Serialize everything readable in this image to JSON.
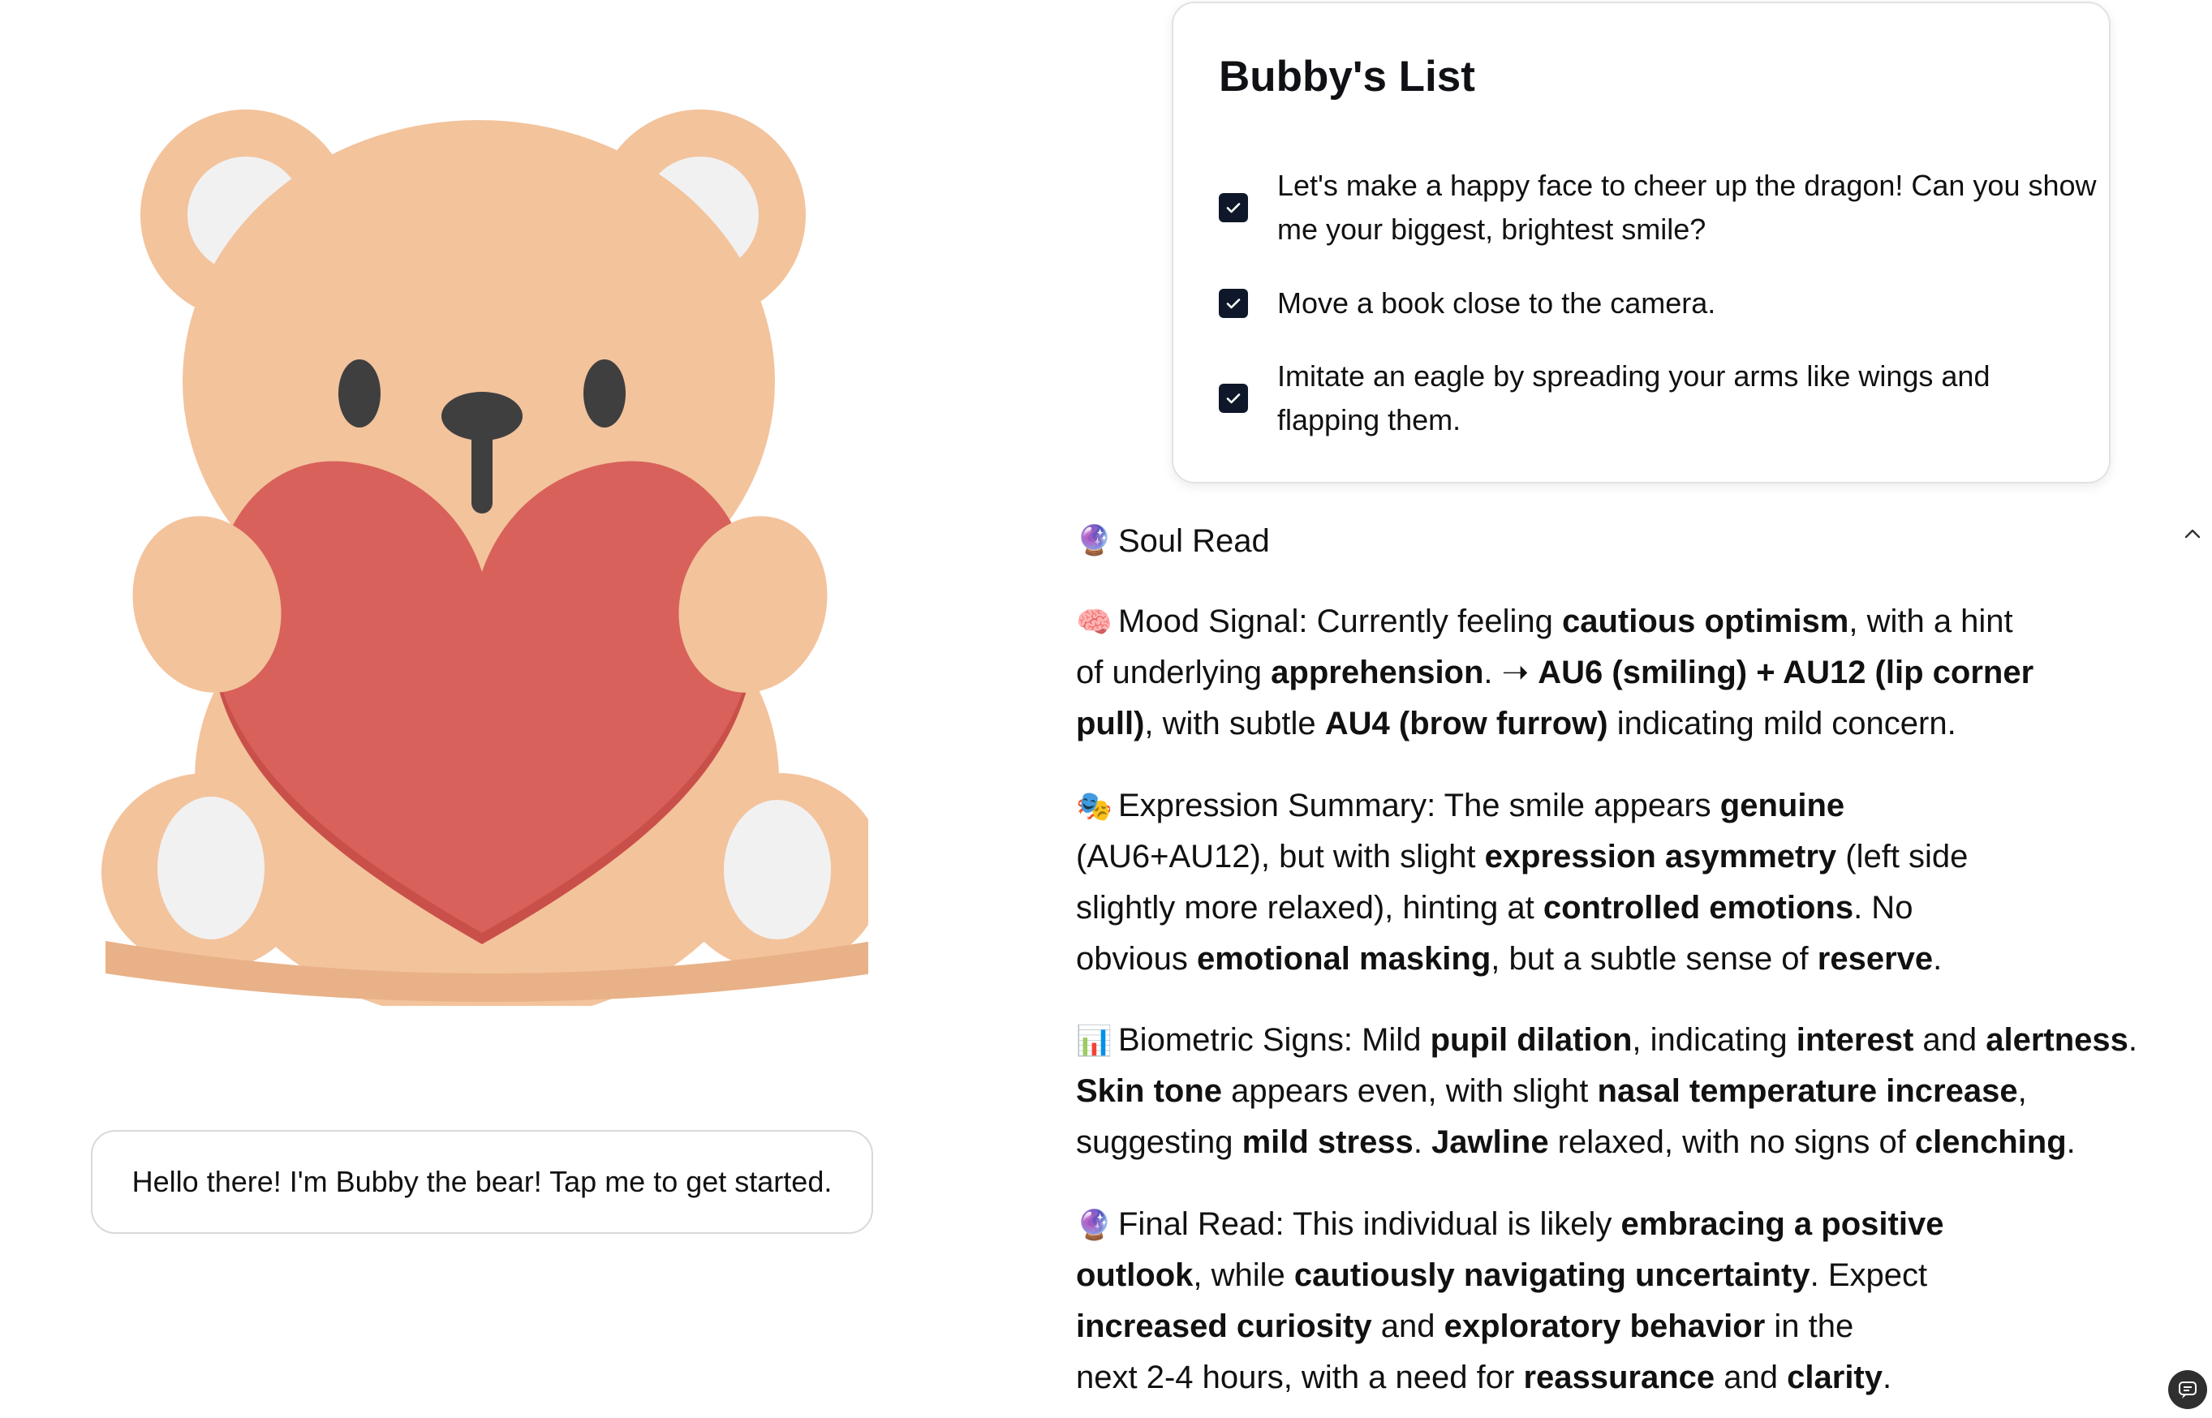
{
  "colors": {
    "bear_fur": "#f3c39c",
    "bear_fur_shadow": "#e9b187",
    "heart": "#d8625b",
    "heart_shadow": "#c9504a",
    "checkbox": "#0f172a",
    "text": "#111111",
    "border": "#d9d9d9"
  },
  "bear": {
    "speech": "Hello there! I'm Bubby the bear! Tap me to get started."
  },
  "list": {
    "title": "Bubby's List",
    "items": [
      {
        "text": "Let's make a happy face to cheer up the dragon! Can you show me your biggest, brightest smile?",
        "checked": true
      },
      {
        "text": "Move a book close to the camera.",
        "checked": true
      },
      {
        "text": "Imitate an eagle by spreading your arms like wings and flapping them.",
        "checked": true
      }
    ]
  },
  "soul_read": {
    "icon": "🔮",
    "title": "Soul Read",
    "collapse_icon": "chevron-up-icon",
    "sections": [
      {
        "icon": "🧠",
        "lines": [
          [
            {
              "t": "Mood Signal: Currently feeling "
            },
            {
              "t": "cautious optimism",
              "b": true
            },
            {
              "t": ", with a hint"
            }
          ],
          [
            {
              "t": "of underlying "
            },
            {
              "t": "apprehension",
              "b": true
            },
            {
              "t": ". ➝ "
            },
            {
              "t": "AU6 (smiling) + AU12 (lip corner",
              "b": true
            }
          ],
          [
            {
              "t": "pull)",
              "b": true
            },
            {
              "t": ", with subtle "
            },
            {
              "t": "AU4 (brow furrow)",
              "b": true
            },
            {
              "t": " indicating mild concern."
            }
          ]
        ]
      },
      {
        "icon": "🎭",
        "lines": [
          [
            {
              "t": "Expression Summary: The smile appears "
            },
            {
              "t": "genuine",
              "b": true
            }
          ],
          [
            {
              "t": "(AU6+AU12), but with slight "
            },
            {
              "t": "expression asymmetry",
              "b": true
            },
            {
              "t": " (left side"
            }
          ],
          [
            {
              "t": "slightly more relaxed), hinting at "
            },
            {
              "t": "controlled emotions",
              "b": true
            },
            {
              "t": ". No"
            }
          ],
          [
            {
              "t": "obvious "
            },
            {
              "t": "emotional masking",
              "b": true
            },
            {
              "t": ", but a subtle sense of "
            },
            {
              "t": "reserve",
              "b": true
            },
            {
              "t": "."
            }
          ]
        ]
      },
      {
        "icon": "📊",
        "lines": [
          [
            {
              "t": "Biometric Signs: Mild "
            },
            {
              "t": "pupil dilation",
              "b": true
            },
            {
              "t": ", indicating "
            },
            {
              "t": "interest",
              "b": true
            },
            {
              "t": " and "
            },
            {
              "t": "alertness",
              "b": true
            },
            {
              "t": "."
            }
          ],
          [
            {
              "t": "Skin tone",
              "b": true
            },
            {
              "t": " appears even, with slight "
            },
            {
              "t": "nasal temperature increase",
              "b": true
            },
            {
              "t": ","
            }
          ],
          [
            {
              "t": "suggesting "
            },
            {
              "t": "mild stress",
              "b": true
            },
            {
              "t": ". "
            },
            {
              "t": "Jawline",
              "b": true
            },
            {
              "t": " relaxed, with no signs of "
            },
            {
              "t": "clenching",
              "b": true
            },
            {
              "t": "."
            }
          ]
        ]
      },
      {
        "icon": "🔮",
        "lines": [
          [
            {
              "t": "Final Read: This individual is likely "
            },
            {
              "t": "embracing a positive",
              "b": true
            }
          ],
          [
            {
              "t": "outlook",
              "b": true
            },
            {
              "t": ", while "
            },
            {
              "t": "cautiously navigating uncertainty",
              "b": true
            },
            {
              "t": ". Expect"
            }
          ],
          [
            {
              "t": "increased curiosity",
              "b": true
            },
            {
              "t": " and "
            },
            {
              "t": "exploratory behavior",
              "b": true
            },
            {
              "t": " in the"
            }
          ],
          [
            {
              "t": "next 2-4 hours, with a need for "
            },
            {
              "t": "reassurance",
              "b": true
            },
            {
              "t": " and "
            },
            {
              "t": "clarity",
              "b": true
            },
            {
              "t": "."
            }
          ]
        ]
      }
    ]
  },
  "corner_icon": "chat-bubble-icon"
}
